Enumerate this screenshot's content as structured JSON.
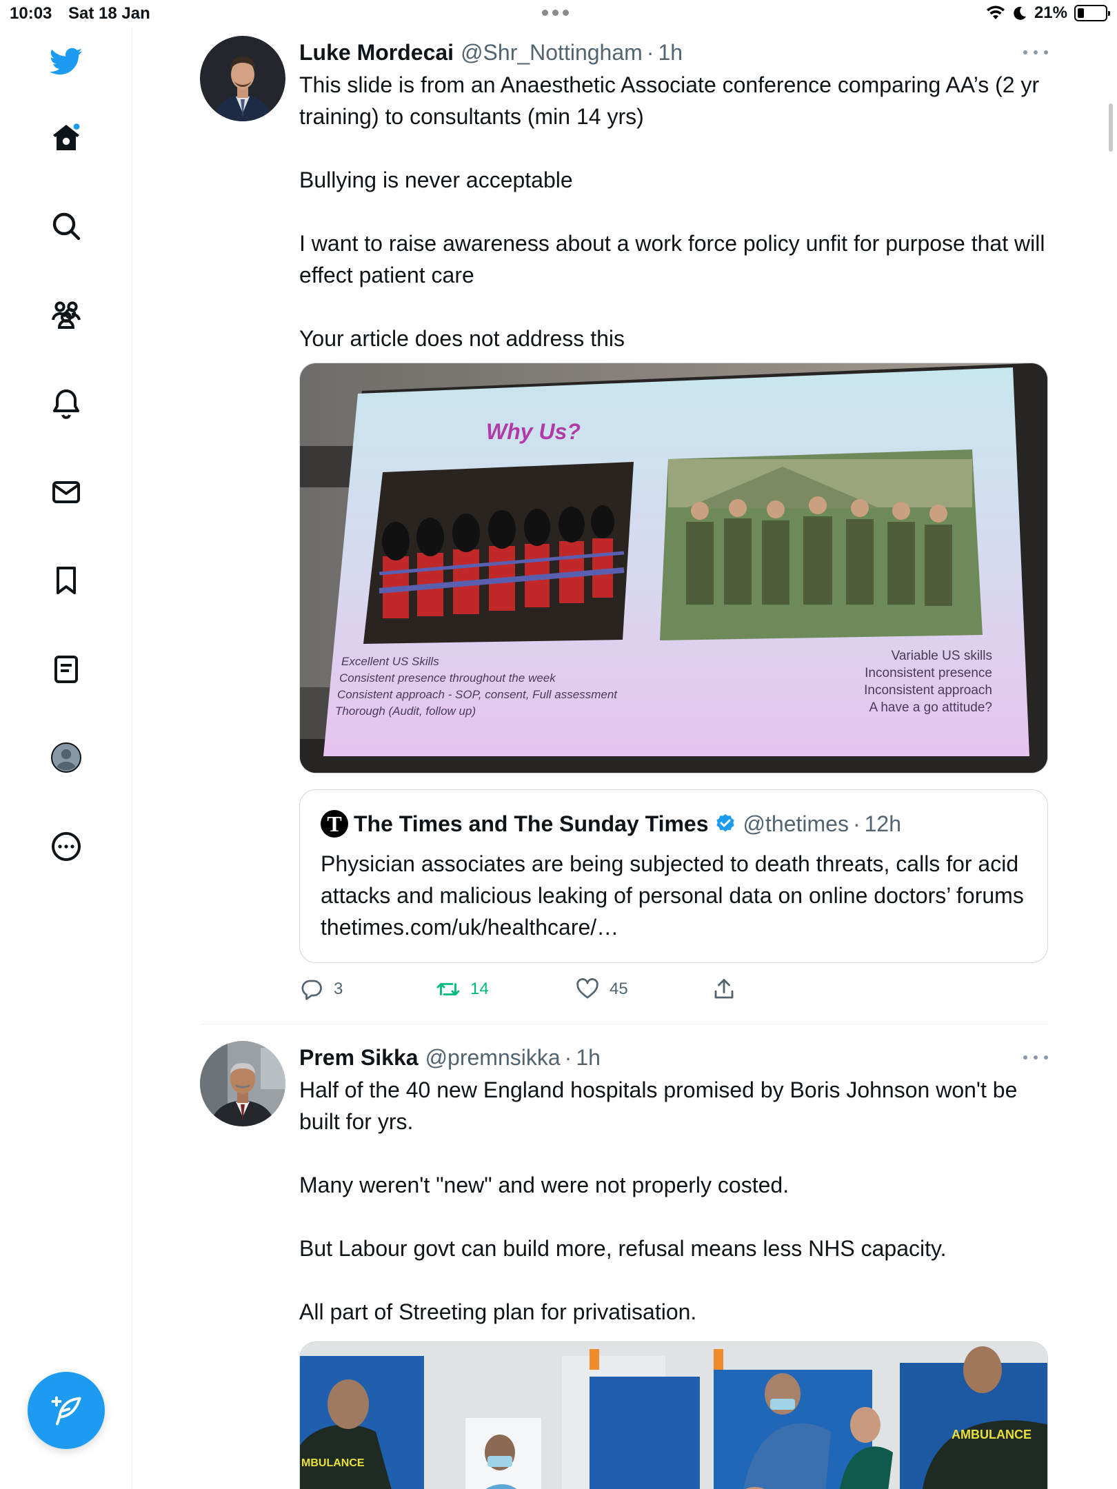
{
  "status_bar": {
    "time": "10:03",
    "date": "Sat 18 Jan",
    "battery": "21%",
    "battery_level": 0.21
  },
  "sidebar": {
    "items": [
      {
        "icon": "twitter-logo-icon"
      },
      {
        "icon": "home-icon",
        "notification_dot": true
      },
      {
        "icon": "search-icon"
      },
      {
        "icon": "communities-icon"
      },
      {
        "icon": "notifications-bell-icon"
      },
      {
        "icon": "messages-envelope-icon"
      },
      {
        "icon": "bookmark-icon"
      },
      {
        "icon": "lists-icon"
      },
      {
        "icon": "profile-avatar-icon"
      },
      {
        "icon": "more-options-icon"
      }
    ],
    "compose_icon": "compose-feather-icon"
  },
  "colors": {
    "accent": "#1d9bf0",
    "retweet_green": "#00ba7c",
    "secondary_text": "#536471",
    "border": "#cfd9de"
  },
  "tweets": [
    {
      "author": "Luke Mordecai",
      "handle": "@Shr_Nottingham",
      "time": "1h",
      "text": "This slide is from an Anaesthetic Associate conference comparing AA’s (2 yr training) to consultants (min 14 yrs)\n\nBullying is never acceptable\n\nI want to raise awareness about a work force policy unfit for purpose that will effect patient care\n\nYour article does not address this",
      "media": {
        "slide_title": "Why Us?",
        "left_caption": [
          "Excellent US Skills",
          "Consistent presence throughout the week",
          "Consistent approach - SOP, consent, Full assessment",
          "Thorough (Audit, follow up)"
        ],
        "right_caption": [
          "Variable US skills",
          "Inconsistent presence",
          "Inconsistent approach",
          "A have a go attitude?"
        ]
      },
      "quote": {
        "author": "The Times and The Sunday Times",
        "logo_letter": "T",
        "handle": "@thetimes",
        "time": "12h",
        "text": "Physician associates are being subjected to death threats, calls for acid attacks and malicious leaking of personal data on online doctors’ forums thetimes.com/uk/healthcare/…"
      },
      "stats": {
        "replies": "3",
        "retweets": "14",
        "likes": "45"
      }
    },
    {
      "author": "Prem Sikka",
      "handle": "@premnsikka",
      "time": "1h",
      "text": "Half of the 40 new England hospitals promised by Boris Johnson won't be built for yrs.\n\nMany weren't \"new\" and were not properly costed.\n\nBut Labour govt can build more, refusal means less NHS capacity.\n\nAll part of Streeting plan for privatisation.",
      "media": {
        "left_badge": "MBULANCE",
        "right_badge": "AMBULANCE"
      }
    }
  ]
}
